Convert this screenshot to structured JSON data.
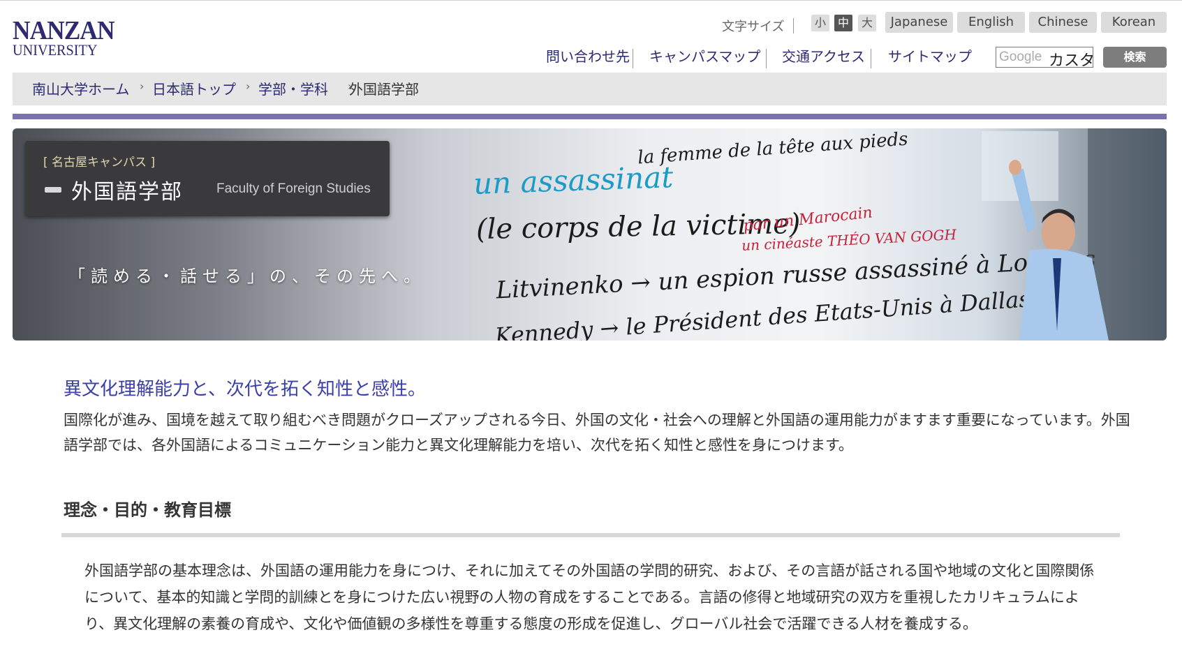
{
  "header": {
    "logo_line1": "NANZAN",
    "logo_line2": "UNIVERSITY",
    "font_size_label": "文字サイズ",
    "font_sizes": [
      "小",
      "中",
      "大"
    ],
    "languages": [
      "Japanese",
      "English",
      "Chinese",
      "Korean"
    ],
    "nav": [
      "問い合わせ先",
      "キャンパスマップ",
      "交通アクセス",
      "サイトマップ"
    ],
    "search": {
      "brand": "Google",
      "value": "カスタ",
      "button": "検索"
    }
  },
  "breadcrumb": [
    "南山大学ホーム",
    "日本語トップ",
    "学部・学科",
    "外国語学部"
  ],
  "hero": {
    "campus": "[ 名古屋キャンパス ]",
    "title": "外国語学部",
    "subtitle": "Faculty of Foreign Studies",
    "tagline": "「読める・話せる」の、その先へ。",
    "board_text": [
      "la femme de la tête aux pieds",
      "un assassinat",
      "(le corps de la victime)",
      "Litvinenko → un espion russe assassiné à Londres",
      "Kennedy → le Président des Etats-Unis à Dallas",
      "par un Marocain",
      "un cinéaste THÉO VAN GOGH"
    ]
  },
  "content": {
    "lead_heading": "異文化理解能力と、次代を拓く知性と感性。",
    "lead_text": "国際化が進み、国境を越えて取り組むべき問題がクローズアップされる今日、外国の文化・社会への理解と外国語の運用能力がますます重要になっています。外国語学部では、各外国語によるコミュニケーション能力と異文化理解能力を培い、次代を拓く知性と感性を身につけます。",
    "section_heading": "理念・目的・教育目標",
    "section_text": "外国語学部の基本理念は、外国語の運用能力を身につけ、それに加えてその外国語の学問的研究、および、その言語が話される国や地域の文化と国際関係について、基本的知識と学問的訓練とを身につけた広い視野の人物の育成をすることである。言語の修得と地域研究の双方を重視したカリキュラムにより、異文化理解の素養の育成や、文化や価値観の多様性を尊重する態度の形成を促進し、グローバル社会で活躍できる人材を養成する。"
  },
  "colors": {
    "brand": "#2d2a73",
    "accent_bar": "#7773b0",
    "lead_heading": "#3b3fa8"
  }
}
